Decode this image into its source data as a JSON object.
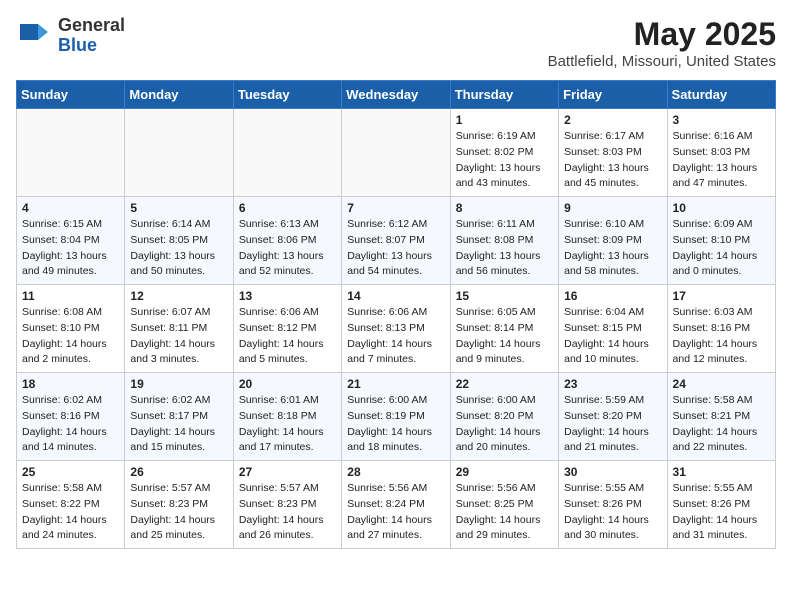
{
  "header": {
    "logo_general": "General",
    "logo_blue": "Blue",
    "title": "May 2025",
    "location": "Battlefield, Missouri, United States"
  },
  "days_of_week": [
    "Sunday",
    "Monday",
    "Tuesday",
    "Wednesday",
    "Thursday",
    "Friday",
    "Saturday"
  ],
  "weeks": [
    [
      {
        "day": "",
        "empty": true
      },
      {
        "day": "",
        "empty": true
      },
      {
        "day": "",
        "empty": true
      },
      {
        "day": "",
        "empty": true
      },
      {
        "day": "1",
        "sunrise": "6:19 AM",
        "sunset": "8:02 PM",
        "daylight": "13 hours and 43 minutes."
      },
      {
        "day": "2",
        "sunrise": "6:17 AM",
        "sunset": "8:03 PM",
        "daylight": "13 hours and 45 minutes."
      },
      {
        "day": "3",
        "sunrise": "6:16 AM",
        "sunset": "8:03 PM",
        "daylight": "13 hours and 47 minutes."
      }
    ],
    [
      {
        "day": "4",
        "sunrise": "6:15 AM",
        "sunset": "8:04 PM",
        "daylight": "13 hours and 49 minutes."
      },
      {
        "day": "5",
        "sunrise": "6:14 AM",
        "sunset": "8:05 PM",
        "daylight": "13 hours and 50 minutes."
      },
      {
        "day": "6",
        "sunrise": "6:13 AM",
        "sunset": "8:06 PM",
        "daylight": "13 hours and 52 minutes."
      },
      {
        "day": "7",
        "sunrise": "6:12 AM",
        "sunset": "8:07 PM",
        "daylight": "13 hours and 54 minutes."
      },
      {
        "day": "8",
        "sunrise": "6:11 AM",
        "sunset": "8:08 PM",
        "daylight": "13 hours and 56 minutes."
      },
      {
        "day": "9",
        "sunrise": "6:10 AM",
        "sunset": "8:09 PM",
        "daylight": "13 hours and 58 minutes."
      },
      {
        "day": "10",
        "sunrise": "6:09 AM",
        "sunset": "8:10 PM",
        "daylight": "14 hours and 0 minutes."
      }
    ],
    [
      {
        "day": "11",
        "sunrise": "6:08 AM",
        "sunset": "8:10 PM",
        "daylight": "14 hours and 2 minutes."
      },
      {
        "day": "12",
        "sunrise": "6:07 AM",
        "sunset": "8:11 PM",
        "daylight": "14 hours and 3 minutes."
      },
      {
        "day": "13",
        "sunrise": "6:06 AM",
        "sunset": "8:12 PM",
        "daylight": "14 hours and 5 minutes."
      },
      {
        "day": "14",
        "sunrise": "6:06 AM",
        "sunset": "8:13 PM",
        "daylight": "14 hours and 7 minutes."
      },
      {
        "day": "15",
        "sunrise": "6:05 AM",
        "sunset": "8:14 PM",
        "daylight": "14 hours and 9 minutes."
      },
      {
        "day": "16",
        "sunrise": "6:04 AM",
        "sunset": "8:15 PM",
        "daylight": "14 hours and 10 minutes."
      },
      {
        "day": "17",
        "sunrise": "6:03 AM",
        "sunset": "8:16 PM",
        "daylight": "14 hours and 12 minutes."
      }
    ],
    [
      {
        "day": "18",
        "sunrise": "6:02 AM",
        "sunset": "8:16 PM",
        "daylight": "14 hours and 14 minutes."
      },
      {
        "day": "19",
        "sunrise": "6:02 AM",
        "sunset": "8:17 PM",
        "daylight": "14 hours and 15 minutes."
      },
      {
        "day": "20",
        "sunrise": "6:01 AM",
        "sunset": "8:18 PM",
        "daylight": "14 hours and 17 minutes."
      },
      {
        "day": "21",
        "sunrise": "6:00 AM",
        "sunset": "8:19 PM",
        "daylight": "14 hours and 18 minutes."
      },
      {
        "day": "22",
        "sunrise": "6:00 AM",
        "sunset": "8:20 PM",
        "daylight": "14 hours and 20 minutes."
      },
      {
        "day": "23",
        "sunrise": "5:59 AM",
        "sunset": "8:20 PM",
        "daylight": "14 hours and 21 minutes."
      },
      {
        "day": "24",
        "sunrise": "5:58 AM",
        "sunset": "8:21 PM",
        "daylight": "14 hours and 22 minutes."
      }
    ],
    [
      {
        "day": "25",
        "sunrise": "5:58 AM",
        "sunset": "8:22 PM",
        "daylight": "14 hours and 24 minutes."
      },
      {
        "day": "26",
        "sunrise": "5:57 AM",
        "sunset": "8:23 PM",
        "daylight": "14 hours and 25 minutes."
      },
      {
        "day": "27",
        "sunrise": "5:57 AM",
        "sunset": "8:23 PM",
        "daylight": "14 hours and 26 minutes."
      },
      {
        "day": "28",
        "sunrise": "5:56 AM",
        "sunset": "8:24 PM",
        "daylight": "14 hours and 27 minutes."
      },
      {
        "day": "29",
        "sunrise": "5:56 AM",
        "sunset": "8:25 PM",
        "daylight": "14 hours and 29 minutes."
      },
      {
        "day": "30",
        "sunrise": "5:55 AM",
        "sunset": "8:26 PM",
        "daylight": "14 hours and 30 minutes."
      },
      {
        "day": "31",
        "sunrise": "5:55 AM",
        "sunset": "8:26 PM",
        "daylight": "14 hours and 31 minutes."
      }
    ]
  ],
  "labels": {
    "sunrise_prefix": "Sunrise: ",
    "sunset_prefix": "Sunset: ",
    "daylight_prefix": "Daylight: "
  }
}
